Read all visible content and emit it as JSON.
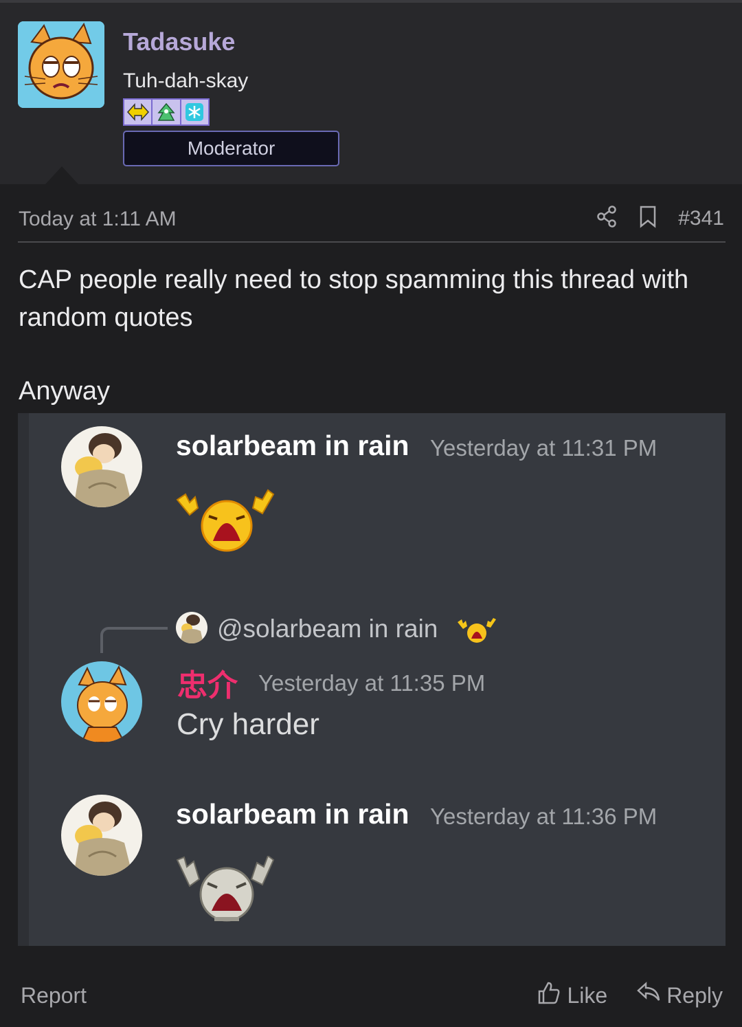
{
  "post": {
    "author": "Tadasuke",
    "user_title": "Tuh-dah-skay",
    "role_badge": "Moderator",
    "timestamp": "Today at 1:11 AM",
    "post_number": "#341",
    "body_text": "CAP people really need to stop spamming this thread with random quotes",
    "body_text_2": "Anyway",
    "badge_icons": [
      "yellow-arrows-badge-icon",
      "green-creature-badge-icon",
      "snowflake-badge-icon"
    ]
  },
  "screenshot": {
    "messages": [
      {
        "author": "solarbeam in rain",
        "time": "Yesterday at 11:31 PM",
        "emoji": "crying-emoji"
      },
      {
        "reply_to": "@solarbeam in rain",
        "author": "忠介",
        "time": "Yesterday at 11:35 PM",
        "text": "Cry harder"
      },
      {
        "author": "solarbeam in rain",
        "time": "Yesterday at 11:36 PM",
        "emoji": "stone-crying-emoji"
      }
    ]
  },
  "footer": {
    "report": "Report",
    "like": "Like",
    "reply": "Reply"
  },
  "colors": {
    "username": "#b6a8d8",
    "cjk_name": "#ee2e6e",
    "panel": "#36393f"
  }
}
